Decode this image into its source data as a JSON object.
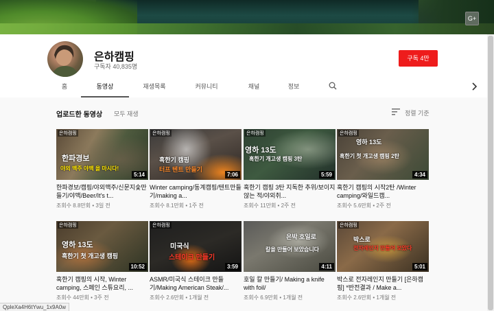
{
  "channel": {
    "name": "은하캠핑",
    "subscribers": "구독자 40,835명",
    "subscribe_label": "구독 4만",
    "social_icon": "G+"
  },
  "tabs": [
    "홈",
    "동영상",
    "재생목록",
    "커뮤니티",
    "채널",
    "정보"
  ],
  "active_tab": "동영상",
  "section": {
    "title": "업로드한 동영상",
    "play_all": "모두 재생",
    "sort_label": "정렬 기준"
  },
  "videos": [
    {
      "title": "한파경보/캠핑/야외맥주/신문지숯만들기/야맥/Beer/It's t...",
      "views": "조회수 8.8만회",
      "age": "3일 전",
      "duration": "5:14",
      "caption1": "한파경보",
      "caption2": "야외 맥주 야맥 을 마시다!"
    },
    {
      "title": "Winter camping/동계캠핑/텐트만들기/making a...",
      "views": "조회수 8.1만회",
      "age": "1주 전",
      "duration": "7:06",
      "caption1": "혹한기 캠핑",
      "caption2": "터프 텐트 만들기"
    },
    {
      "title": "혹한기 캠핑 3탄 지독한 추위/보이지 않는 적/야외취...",
      "views": "조회수 11만회",
      "age": "2주 전",
      "duration": "5:59",
      "caption1": "영하 13도",
      "caption2": "혹한기 개고생 캠핑 3탄"
    },
    {
      "title": "혹한기 캠핑의 시작2탄 /Winter camping/와일드캠...",
      "views": "조회수 5.6만회",
      "age": "2주 전",
      "duration": "4:34",
      "caption1": "영하 13도",
      "caption2": "혹한기 첫 개고생 캠핑 2탄"
    },
    {
      "title": "혹한기 캠핑의 시작, Winter camping, 스페인 스튜요리, ...",
      "views": "조회수 44만회",
      "age": "3주 전",
      "duration": "10:52",
      "caption1": "영하 13도",
      "caption2": "혹한기 첫 개고생 캠핑"
    },
    {
      "title": "ASMR/미국식 스테이크 만들기/Making American Steak/...",
      "views": "조회수 2.6만회",
      "age": "1개월 전",
      "duration": "3:59",
      "caption1": "미국식",
      "caption2": "스테이크 만들기"
    },
    {
      "title": "호일 칼 만들기/ Making a knife with foil/",
      "views": "조회수 6.9만회",
      "age": "1개월 전",
      "duration": "4:11",
      "caption1": "은박 호일로",
      "caption2": "칼을 만들어 보았습니다"
    },
    {
      "title": "박스로 전자레인지 만들기 [은하캠핑] *반전결과 / Make a...",
      "views": "조회수 2.6만회",
      "age": "1개월 전",
      "duration": "5:01",
      "caption1": "박스로",
      "caption2": "전자레인지 만들어 보았다"
    }
  ],
  "status_url": "QpleXa4H6tYwu_1x9A0w",
  "colors": {
    "subscribe": "#ee1c1c",
    "background": "#f9f9f9"
  }
}
